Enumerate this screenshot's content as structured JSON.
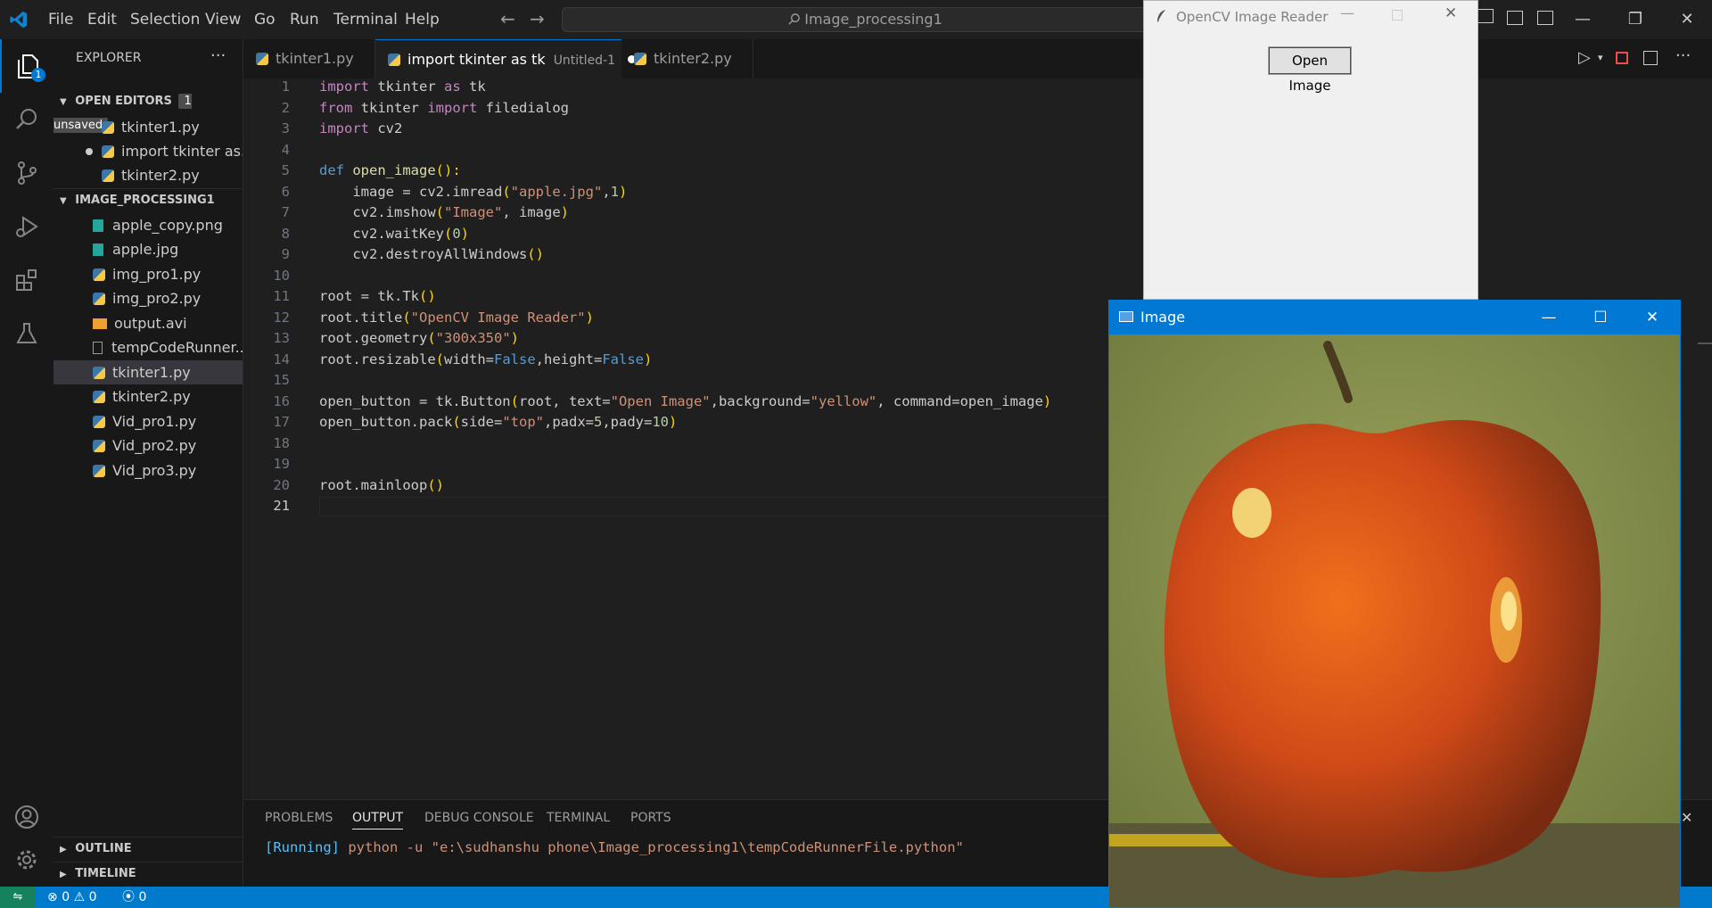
{
  "titlebar": {
    "menu": [
      "File",
      "Edit",
      "Selection",
      "View",
      "Go",
      "Run",
      "Terminal",
      "Help"
    ],
    "search": "Image_processing1"
  },
  "activity": {
    "badge": "1"
  },
  "sidebar": {
    "title": "EXPLORER",
    "open_editors": {
      "label": "OPEN EDITORS",
      "badge": "1 unsaved",
      "items": [
        "tkinter1.py",
        "import tkinter as...",
        "tkinter2.py"
      ]
    },
    "folder": {
      "label": "IMAGE_PROCESSING1",
      "items": [
        {
          "name": "apple_copy.png",
          "type": "image"
        },
        {
          "name": "apple.jpg",
          "type": "image"
        },
        {
          "name": "img_pro1.py",
          "type": "python"
        },
        {
          "name": "img_pro2.py",
          "type": "python"
        },
        {
          "name": "output.avi",
          "type": "video"
        },
        {
          "name": "tempCodeRunner...",
          "type": "text"
        },
        {
          "name": "tkinter1.py",
          "type": "python"
        },
        {
          "name": "tkinter2.py",
          "type": "python"
        },
        {
          "name": "Vid_pro1.py",
          "type": "python"
        },
        {
          "name": "Vid_pro2.py",
          "type": "python"
        },
        {
          "name": "Vid_pro3.py",
          "type": "python"
        }
      ]
    },
    "outline": "OUTLINE",
    "timeline": "TIMELINE"
  },
  "tabs": [
    {
      "label": "tkinter1.py",
      "desc": ""
    },
    {
      "label": "import tkinter as tk",
      "desc": "Untitled-1"
    },
    {
      "label": "tkinter2.py",
      "desc": ""
    }
  ],
  "editor": {
    "line_numbers": [
      "1",
      "2",
      "3",
      "4",
      "5",
      "6",
      "7",
      "8",
      "9",
      "10",
      "11",
      "12",
      "13",
      "14",
      "15",
      "16",
      "17",
      "18",
      "19",
      "20",
      "21"
    ]
  },
  "panel": {
    "tabs": [
      "PROBLEMS",
      "OUTPUT",
      "DEBUG CONSOLE",
      "TERMINAL",
      "PORTS"
    ],
    "output_tag": "[Running]",
    "output_text": " python -u \"e:\\sudhanshu phone\\Image_processing1\\tempCodeRunnerFile.python\""
  },
  "status": {
    "errors": "0",
    "warnings": "0",
    "ports": "0"
  },
  "cv_window": {
    "title": "OpenCV Image Reader",
    "button": "Open Image"
  },
  "image_window": {
    "title": "Image"
  }
}
